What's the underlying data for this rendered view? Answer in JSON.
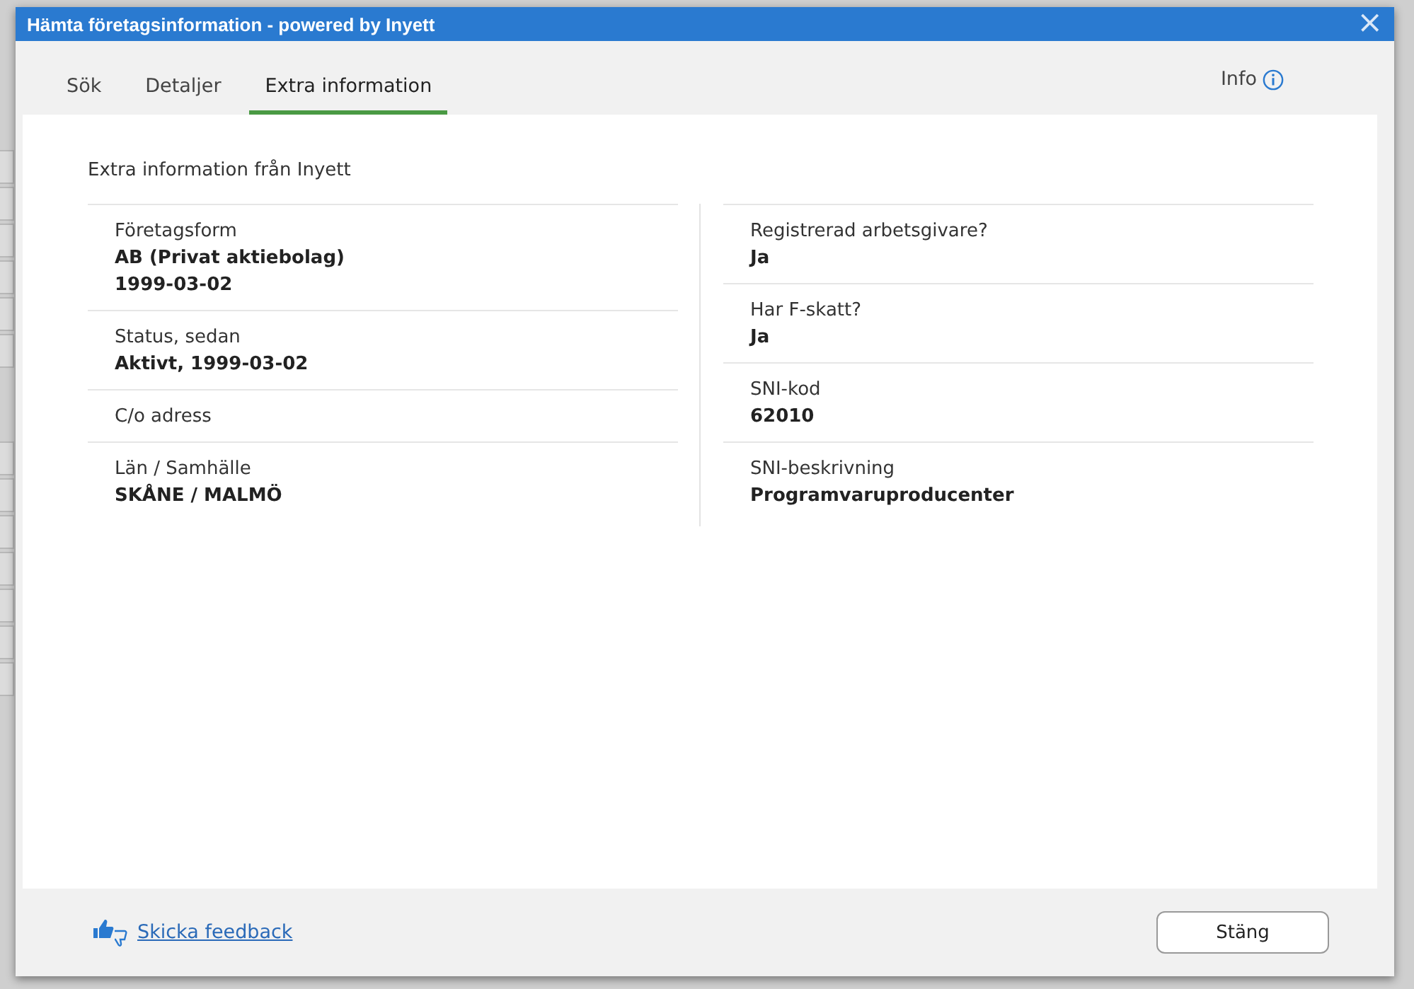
{
  "window": {
    "title": "Hämta företagsinformation - powered by Inyett",
    "close": "×"
  },
  "tabs": [
    {
      "label": "Sök",
      "selected": false
    },
    {
      "label": "Detaljer",
      "selected": false
    },
    {
      "label": "Extra information",
      "selected": true
    }
  ],
  "info_link": "Info",
  "section_title": "Extra information från Inyett",
  "columns": [
    {
      "fields": [
        {
          "label": "Företagsform",
          "values": [
            "AB (Privat aktiebolag)",
            "1999-03-02"
          ]
        },
        {
          "label": "Status, sedan",
          "values": [
            "Aktivt, 1999-03-02"
          ]
        },
        {
          "label": "C/o adress"
        },
        {
          "label": "Län / Samhälle",
          "values": [
            "SKÅNE / MALMÖ"
          ]
        }
      ]
    },
    {
      "fields": [
        {
          "label": "Registrerad arbetsgivare?",
          "values": [
            "Ja"
          ]
        },
        {
          "label": "Har F-skatt?",
          "values": [
            "Ja"
          ]
        },
        {
          "label": "SNI-kod",
          "values": [
            "62010"
          ]
        },
        {
          "label": "SNI-beskrivning",
          "values": [
            "Programvaruproducenter"
          ]
        }
      ]
    }
  ],
  "footer": {
    "feedback_link": "Skicka feedback",
    "close_button": "Stäng"
  }
}
